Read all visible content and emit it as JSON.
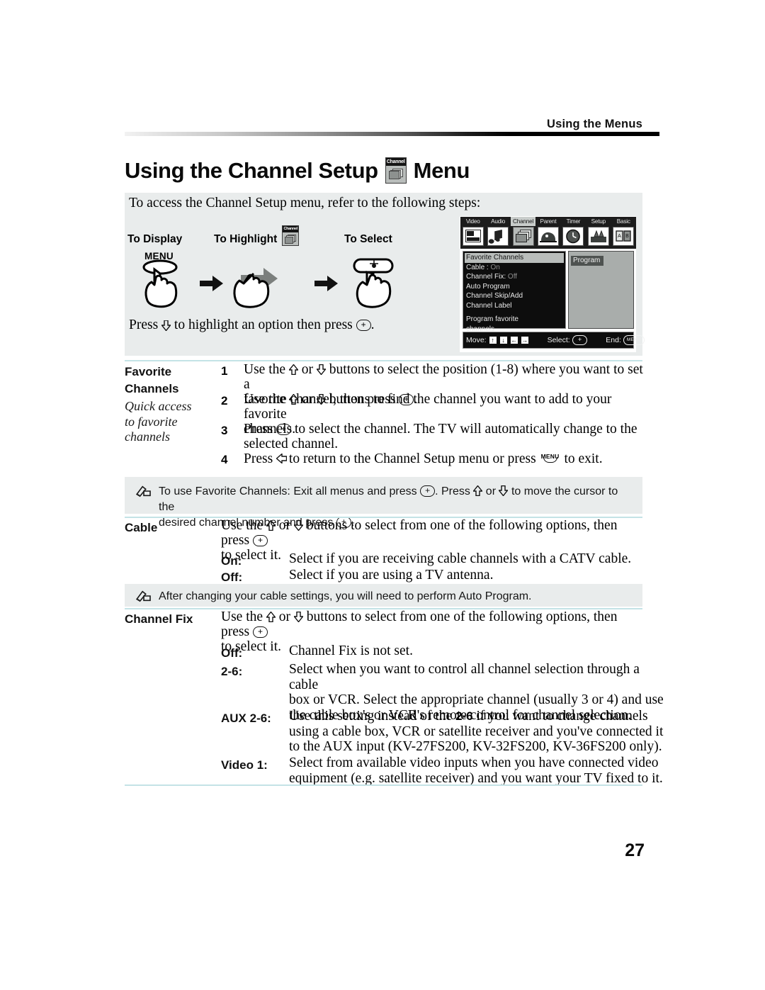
{
  "header": {
    "running_head": "Using the Menus"
  },
  "title": {
    "text_before": "Using the Channel Setup",
    "icon_label": "Channel",
    "icon_name": "channel-menu-icon",
    "text_after": "Menu"
  },
  "intro": {
    "lead": "To access the Channel Setup menu, refer to the following steps:",
    "step_labels": {
      "display": "To Display",
      "highlight": "To Highlight",
      "select": "To Select"
    },
    "menu_button_label": "MENU",
    "press_line_pre": "Press",
    "press_line_mid": "to highlight an option then press",
    "press_line_end": "."
  },
  "osd": {
    "tabs": [
      {
        "label": "Video",
        "icon": "video-icon",
        "selected": false
      },
      {
        "label": "Audio",
        "icon": "audio-note-icon",
        "selected": false
      },
      {
        "label": "Channel",
        "icon": "channel-stack-icon",
        "selected": true
      },
      {
        "label": "Parent",
        "icon": "parental-dog-icon",
        "selected": false
      },
      {
        "label": "Timer",
        "icon": "clock-icon",
        "selected": false
      },
      {
        "label": "Setup",
        "icon": "setup-icon",
        "selected": false
      },
      {
        "label": "Basic",
        "icon": "basic-blocks-icon",
        "selected": false
      }
    ],
    "menu_items": [
      {
        "label": "Favorite Channels",
        "value": "",
        "highlighted": true
      },
      {
        "label": "Cable :",
        "value": "On",
        "highlighted": false
      },
      {
        "label": "Channel Fix:",
        "value": "Off",
        "highlighted": false
      },
      {
        "label": "Auto Program",
        "value": "",
        "highlighted": false
      },
      {
        "label": "Channel Skip/Add",
        "value": "",
        "highlighted": false
      },
      {
        "label": "Channel Label",
        "value": "",
        "highlighted": false
      }
    ],
    "hint_line1": "Program favorite",
    "hint_line2": "channels",
    "right_panel_label": "Program",
    "footer": {
      "move_label": "Move:",
      "move_keys": [
        "↑",
        "↓",
        "←",
        "→"
      ],
      "select_label": "Select:",
      "select_key": "+",
      "end_label": "End:",
      "end_key": "MENU"
    }
  },
  "sections": [
    {
      "term": "Favorite",
      "term2": "Channels",
      "subtitle": [
        "Quick access",
        "to favorite",
        "channels"
      ],
      "steps": [
        {
          "n": "1",
          "lines": [
            "Use the ⇧ or ⇩ buttons to select the position (1-8) where you want to set a",
            "favorite channel, then press ⊕."
          ]
        },
        {
          "n": "2",
          "lines": [
            "Use the ⇧ or ⇩ buttons to find the channel you want to add to your favorite",
            "channels."
          ]
        },
        {
          "n": "3",
          "lines": [
            "Press ⊕ to select the channel. The TV will automatically change to the",
            "selected channel."
          ]
        },
        {
          "n": "4",
          "lines": [
            "Press ⇦ to return to the Channel Setup menu or press MENU to exit."
          ]
        }
      ]
    }
  ],
  "note1": {
    "icon": "note-pencil-icon",
    "line1_a": "To use Favorite Channels: Exit all menus and press",
    "line1_b": ". Press",
    "line1_c": "or",
    "line1_d": "to move the cursor to the",
    "line2_a": "desired channel number and press",
    "line2_b": "."
  },
  "cable": {
    "term": "Cable",
    "desc_line1_a": "Use the",
    "desc_line1_b": "or",
    "desc_line1_c": "buttons to select from one of the following options, then press",
    "desc_line2": "to select it.",
    "options": [
      {
        "name": "On:",
        "desc": "Select if you are receiving cable channels with a CATV cable."
      },
      {
        "name": "Off:",
        "desc": "Select if you are using a TV antenna."
      }
    ]
  },
  "note2": {
    "icon": "note-pencil-icon",
    "text": "After changing your cable settings, you will need to perform Auto Program."
  },
  "channel_fix": {
    "term": "Channel Fix",
    "desc_line1_a": "Use the",
    "desc_line1_b": "or",
    "desc_line1_c": "buttons to select from one of the following options, then press",
    "desc_line2": "to select it.",
    "options": [
      {
        "name": "Off:",
        "lines": [
          "Channel Fix is not set."
        ]
      },
      {
        "name": "2-6:",
        "lines": [
          "Select when you want to control all channel selection through a cable",
          "box or VCR. Select the appropriate channel (usually 3 or 4) and use",
          "the cable box's or VCR's remote control for channel selection."
        ]
      },
      {
        "name": "AUX 2-6:",
        "lines_rich": [
          {
            "pre": "Use this setting instead of the ",
            "bold": "2-6",
            "post": " if you want to change channels"
          },
          {
            "pre": "using a cable box, VCR or satellite receiver and you've connected it",
            "bold": "",
            "post": ""
          },
          {
            "pre": "to the AUX input (KV-27FS200, KV-32FS200, KV-36FS200 only).",
            "bold": "",
            "post": ""
          }
        ]
      },
      {
        "name": "Video 1:",
        "lines": [
          "Select from available video inputs when you have connected video",
          "equipment (e.g. satellite receiver) and you want your TV fixed to it."
        ]
      }
    ]
  },
  "footer": {
    "page_number": "27"
  },
  "colors": {
    "panel_gray": "#e9ecec",
    "rule_cyan": "#c4e3e6",
    "osd_dark": "#0d0d0d",
    "osd_highlight": "#b9bdbb"
  }
}
